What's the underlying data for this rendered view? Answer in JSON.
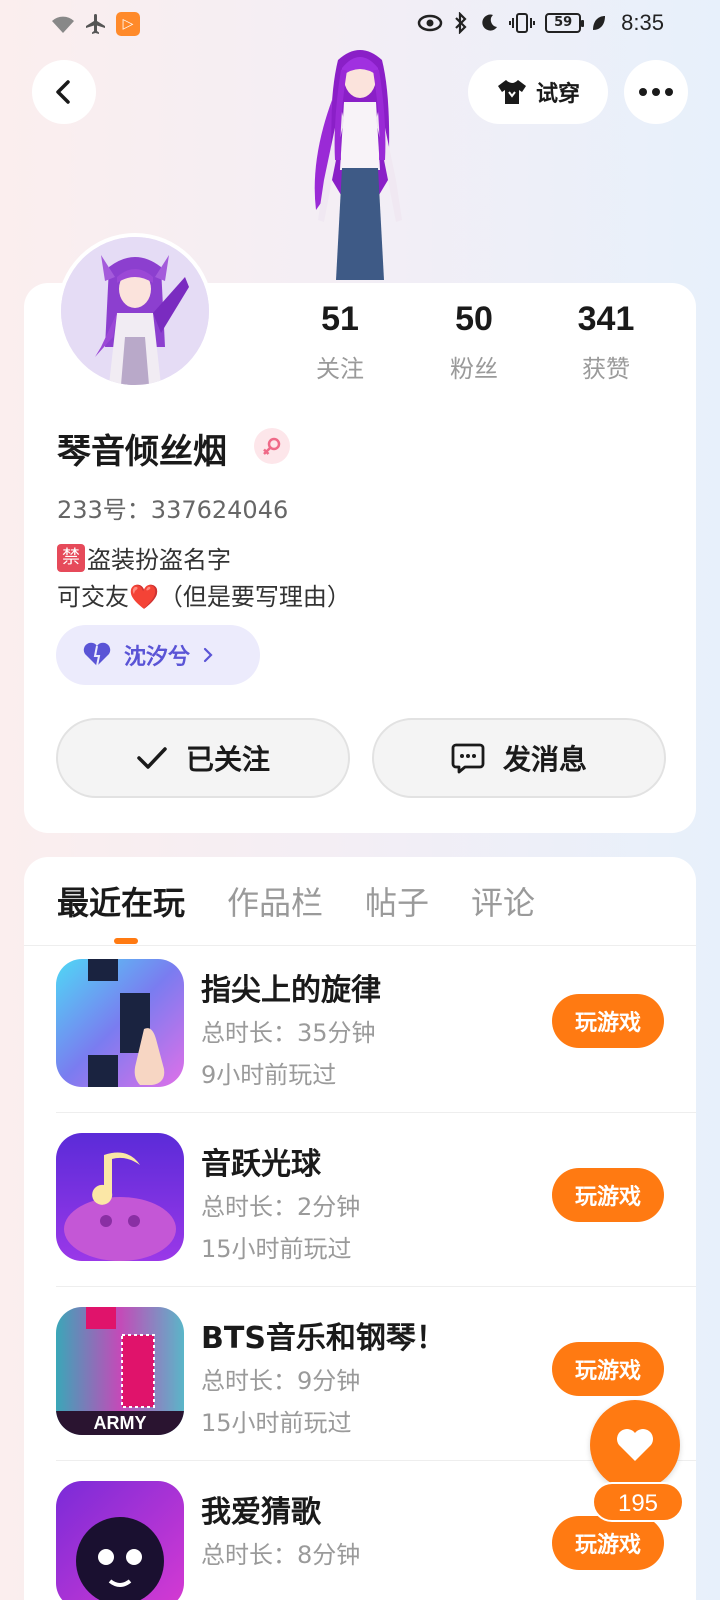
{
  "status_bar": {
    "time": "8:35",
    "battery": "59",
    "app_badge": "▷"
  },
  "header": {
    "tryon_label": "试穿"
  },
  "profile": {
    "stats": [
      {
        "value": "51",
        "label": "关注"
      },
      {
        "value": "50",
        "label": "粉丝"
      },
      {
        "value": "341",
        "label": "获赞"
      }
    ],
    "username": "琴音倾丝烟",
    "uid": "233号：337624046",
    "bio_line1_badge": "禁",
    "bio_line1": "盗装扮盗名字",
    "bio_line2": "可交友❤️（但是要写理由）",
    "cp_name": "沈汐兮",
    "follow_label": "已关注",
    "message_label": "发消息"
  },
  "tabs": [
    {
      "label": "最近在玩",
      "active": true
    },
    {
      "label": "作品栏",
      "active": false
    },
    {
      "label": "帖子",
      "active": false
    },
    {
      "label": "评论",
      "active": false
    }
  ],
  "games": [
    {
      "title": "指尖上的旋律",
      "duration": "总时长：35分钟",
      "last_played": "9小时前玩过",
      "button": "玩游戏"
    },
    {
      "title": "音跃光球",
      "duration": "总时长：2分钟",
      "last_played": "15小时前玩过",
      "button": "玩游戏"
    },
    {
      "title": "BTS音乐和钢琴！",
      "duration": "总时长：9分钟",
      "last_played": "15小时前玩过",
      "button": "玩游戏",
      "icon_text": "ARMY"
    },
    {
      "title": "我爱猜歌",
      "duration": "总时长：8分钟",
      "last_played": "",
      "button": "玩游戏"
    }
  ],
  "like_count": "195",
  "colors": {
    "accent": "#ff7a12",
    "cp_text": "#5a54d6",
    "cp_bg": "#ecebfc"
  }
}
